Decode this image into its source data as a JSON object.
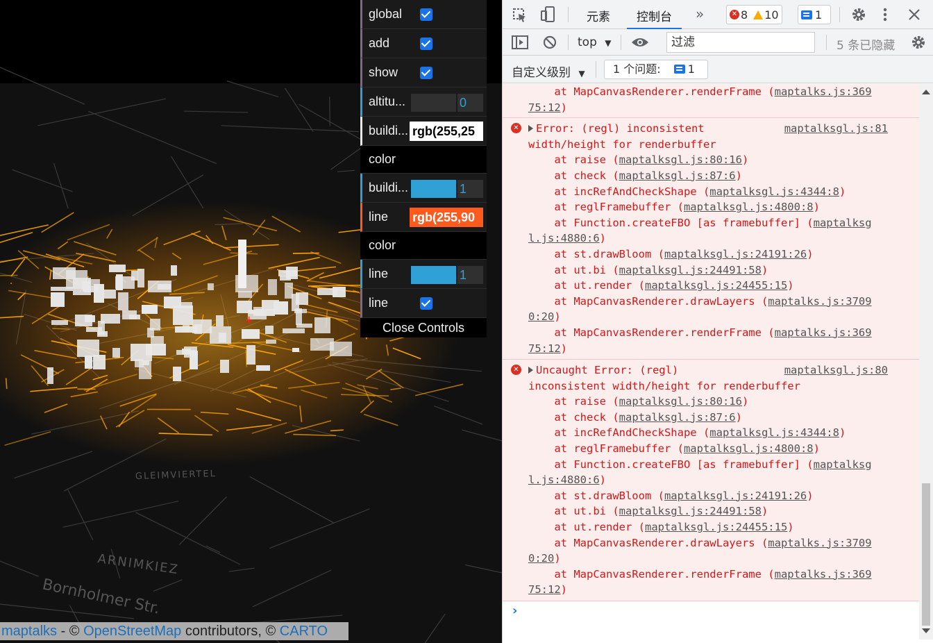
{
  "map": {
    "attribution": {
      "maptalks": "maptalks",
      "sep1": " - © ",
      "osm": "OpenStreetMap",
      "contrib": " contributors, © ",
      "carto": "CARTO"
    },
    "street_labels": [
      "GLEIMVIERTEL",
      "ARNIMKIEZ",
      "Bornholmer Str."
    ]
  },
  "gui": {
    "rows": [
      {
        "label": "global",
        "type": "checkbox",
        "checked": true
      },
      {
        "label": "add",
        "type": "checkbox",
        "checked": true
      },
      {
        "label": "show",
        "type": "checkbox",
        "checked": true
      },
      {
        "label": "altitu...",
        "type": "number",
        "value": "0"
      },
      {
        "label": "buildi...",
        "type": "text",
        "value": "rgb(255,25"
      },
      {
        "label": "color",
        "type": "title"
      },
      {
        "label": "buildi...",
        "type": "slider",
        "value": "1",
        "fill": 1
      },
      {
        "label": "line",
        "type": "text",
        "value": "rgb(255,90"
      },
      {
        "label": "color",
        "type": "title"
      },
      {
        "label": "line",
        "type": "slider",
        "value": "1",
        "fill": 1
      },
      {
        "label": "line",
        "type": "checkbox",
        "checked": true
      }
    ],
    "close_label": "Close Controls",
    "accent_line_color": "#ff5a1e",
    "accent_number_color": "#2fa1d6"
  },
  "devtools": {
    "tabs": {
      "elements": "元素",
      "console": "控制台",
      "more": "»"
    },
    "counts": {
      "errors": "8",
      "warnings": "10",
      "messages": "1"
    },
    "toolbar2": {
      "context": "top",
      "filter_placeholder": "过滤",
      "hidden": "5 条已隐藏"
    },
    "toolbar3": {
      "levels": "自定义级别",
      "issues_label": "1 个问题:",
      "issues_count": "1"
    },
    "console": {
      "top_lines": [
        {
          "text": "    at MapCanvasRenderer.renderFrame (",
          "link": "maptalks.js:369"
        },
        {
          "text": "",
          "link": "75:12",
          "close": ")"
        }
      ],
      "entries": [
        {
          "source": "maptalksgl.js:81",
          "head": [
            "Error: (regl) inconsistent",
            "width/height for renderbuffer"
          ],
          "frames": [
            {
              "text": "    at raise (",
              "link": "maptalksgl.js:80:16",
              "close": ")"
            },
            {
              "text": "    at check (",
              "link": "maptalksgl.js:87:6",
              "close": ")"
            },
            {
              "text": "    at incRefAndCheckShape (",
              "link": "maptalksgl.js:4344:8",
              "close": ")"
            },
            {
              "text": "    at reglFramebuffer (",
              "link": "maptalksgl.js:4800:8",
              "close": ")"
            },
            {
              "text": "    at Function.createFBO [as framebuffer] (",
              "link": "maptalksg",
              "close": ""
            },
            {
              "text": "",
              "link": "l.js:4880:6",
              "close": ")"
            },
            {
              "text": "    at st.drawBloom (",
              "link": "maptalksgl.js:24191:26",
              "close": ")"
            },
            {
              "text": "    at ut.bi (",
              "link": "maptalksgl.js:24491:58",
              "close": ")"
            },
            {
              "text": "    at ut.render (",
              "link": "maptalksgl.js:24455:15",
              "close": ")"
            },
            {
              "text": "    at MapCanvasRenderer.drawLayers (",
              "link": "maptalks.js:3709",
              "close": ""
            },
            {
              "text": "",
              "link": "0:20",
              "close": ")"
            },
            {
              "text": "    at MapCanvasRenderer.renderFrame (",
              "link": "maptalks.js:369",
              "close": ""
            },
            {
              "text": "",
              "link": "75:12",
              "close": ")"
            }
          ]
        },
        {
          "source": "maptalksgl.js:80",
          "head": [
            "Uncaught Error: (regl)",
            "inconsistent width/height for renderbuffer"
          ],
          "frames": [
            {
              "text": "    at raise (",
              "link": "maptalksgl.js:80:16",
              "close": ")"
            },
            {
              "text": "    at check (",
              "link": "maptalksgl.js:87:6",
              "close": ")"
            },
            {
              "text": "    at incRefAndCheckShape (",
              "link": "maptalksgl.js:4344:8",
              "close": ")"
            },
            {
              "text": "    at reglFramebuffer (",
              "link": "maptalksgl.js:4800:8",
              "close": ")"
            },
            {
              "text": "    at Function.createFBO [as framebuffer] (",
              "link": "maptalksg",
              "close": ""
            },
            {
              "text": "",
              "link": "l.js:4880:6",
              "close": ")"
            },
            {
              "text": "    at st.drawBloom (",
              "link": "maptalksgl.js:24191:26",
              "close": ")"
            },
            {
              "text": "    at ut.bi (",
              "link": "maptalksgl.js:24491:58",
              "close": ")"
            },
            {
              "text": "    at ut.render (",
              "link": "maptalksgl.js:24455:15",
              "close": ")"
            },
            {
              "text": "    at MapCanvasRenderer.drawLayers (",
              "link": "maptalks.js:3709",
              "close": ""
            },
            {
              "text": "",
              "link": "0:20",
              "close": ")"
            },
            {
              "text": "    at MapCanvasRenderer.renderFrame (",
              "link": "maptalks.js:369",
              "close": ""
            },
            {
              "text": "",
              "link": "75:12",
              "close": ")"
            }
          ]
        }
      ]
    }
  }
}
